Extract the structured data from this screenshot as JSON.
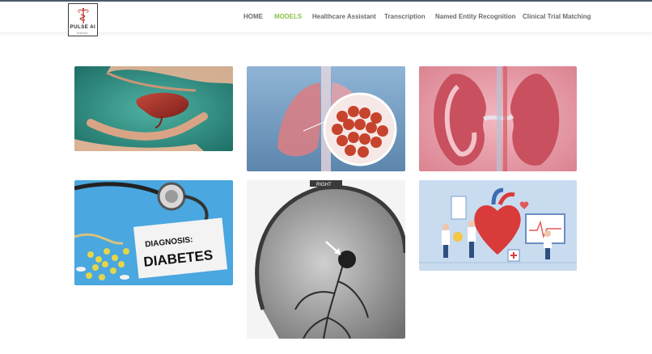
{
  "brand": {
    "name": "PULSE AI",
    "tagline": "PORTAL"
  },
  "nav": {
    "items": [
      {
        "label": "HOME",
        "active": false
      },
      {
        "label": "MODELS",
        "active": true
      },
      {
        "label": "Healthcare Assistant",
        "active": false
      },
      {
        "label": "Transcription",
        "active": false
      },
      {
        "label": "Named Entity Recognition",
        "active": false
      },
      {
        "label": "Clinical Trial Matching",
        "active": false
      }
    ],
    "active_color": "#8bc34a",
    "text_color": "#6b6b6b"
  },
  "gallery": {
    "tiles": [
      {
        "subject": "liver-held-in-hands",
        "text": ""
      },
      {
        "subject": "lungs-infection",
        "text": ""
      },
      {
        "subject": "kidney-cross-section",
        "text": ""
      },
      {
        "subject": "diabetes-diagnosis",
        "text": "DIAGNOSIS:\nDIABETES",
        "line1": "DIAGNOSIS:",
        "line2": "DIABETES"
      },
      {
        "subject": "brain-angiogram",
        "text": "RIGHT"
      },
      {
        "subject": "heart-doctors-illustration",
        "text": ""
      }
    ]
  }
}
